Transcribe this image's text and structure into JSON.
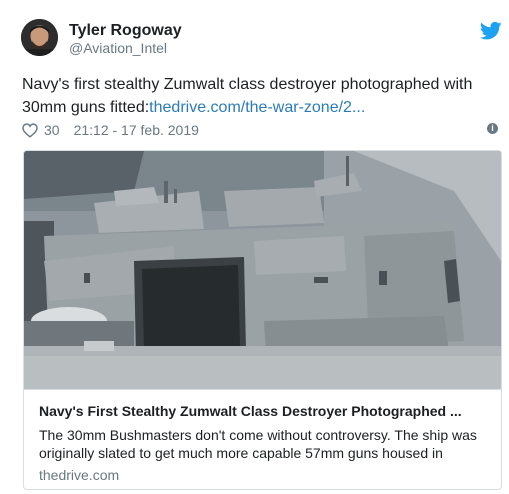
{
  "author": {
    "name": "Tyler Rogoway",
    "handle": "@Aviation_Intel"
  },
  "tweet": {
    "text": "Navy's first stealthy Zumwalt class destroyer photographed with 30mm guns fitted:",
    "link": "thedrive.com/the-war-zone/2..."
  },
  "meta": {
    "likes": "30",
    "timestamp": "21:12 - 17 feb. 2019"
  },
  "card": {
    "title": "Navy's First Stealthy Zumwalt Class Destroyer Photographed ...",
    "description": "The 30mm Bushmasters don't come without controversy. The ship was originally slated to get much more capable 57mm guns housed in",
    "domain": "thedrive.com"
  },
  "icons": {
    "brand": "twitter-bird-icon",
    "like": "heart-icon",
    "info": "info-icon"
  },
  "colors": {
    "brand": "#1da1f2",
    "link": "#2b7bb9",
    "secondary": "#697882",
    "text": "#1c2022"
  }
}
